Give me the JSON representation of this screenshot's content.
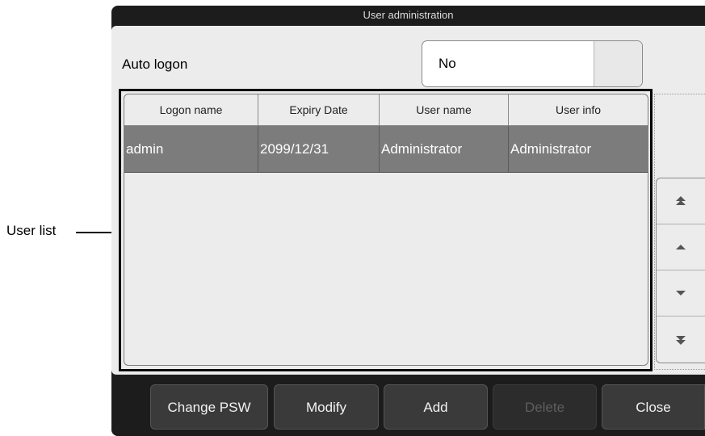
{
  "callout": {
    "label": "User list"
  },
  "window": {
    "title": "User administration"
  },
  "auto_logon": {
    "label": "Auto logon",
    "value": "No"
  },
  "user_list": {
    "columns": [
      "Logon name",
      "Expiry Date",
      "User name",
      "User info"
    ],
    "rows": [
      {
        "logon_name": "admin",
        "expiry_date": "2099/12/31",
        "user_name": "Administrator",
        "user_info": "Administrator",
        "selected": true
      }
    ]
  },
  "scroll": {
    "icons": [
      "scroll-to-top-icon",
      "scroll-up-icon",
      "scroll-down-icon",
      "scroll-to-bottom-icon"
    ]
  },
  "buttons": {
    "change_psw": "Change PSW",
    "modify": "Modify",
    "add": "Add",
    "delete": "Delete",
    "close": "Close"
  },
  "colors": {
    "window_bg": "#1c1c1c",
    "panel_bg": "#ececec",
    "selected_row": "#7c7c7c",
    "button_bg": "#3a3a3a"
  }
}
